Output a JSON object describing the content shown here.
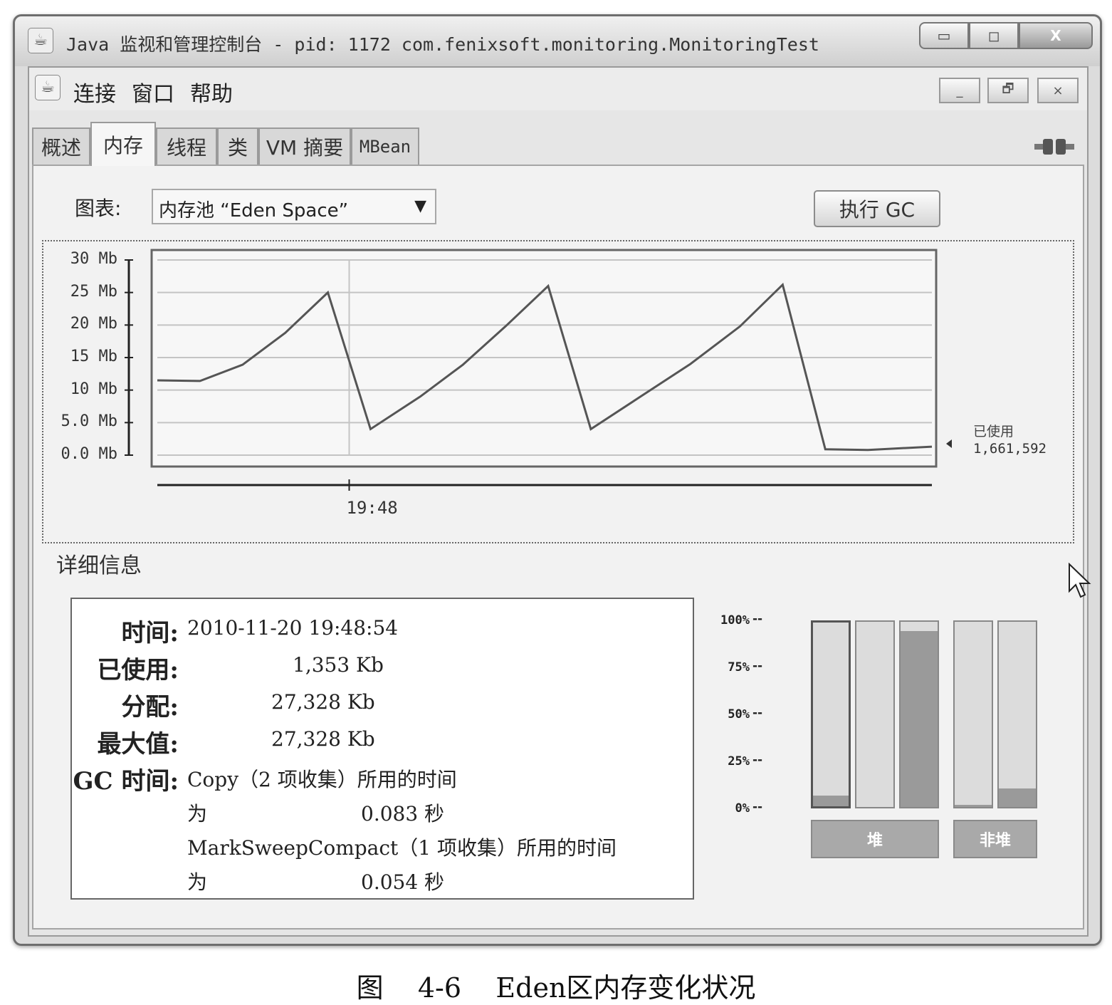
{
  "window": {
    "title": "Java 监视和管理控制台 - pid: 1172 com.fenixsoft.monitoring.MonitoringTest",
    "controls": {
      "minimize": "▭",
      "maximize": "◻",
      "close": "X"
    }
  },
  "menu": {
    "items": [
      "连接",
      "窗口",
      "帮助"
    ],
    "controls": {
      "minimize": "_",
      "restore": "🗗",
      "close": "×"
    }
  },
  "tabs": [
    {
      "label": "概述",
      "active": false
    },
    {
      "label": "内存",
      "active": true
    },
    {
      "label": "线程",
      "active": false
    },
    {
      "label": "类",
      "active": false
    },
    {
      "label": "VM 摘要",
      "active": false
    },
    {
      "label": "MBean",
      "active": false
    }
  ],
  "toolbar": {
    "chart_label": "图表:",
    "chart_select_value": "内存池 “Eden Space”",
    "gc_button": "执行 GC"
  },
  "chart_data": {
    "type": "line",
    "y_tick_labels": [
      "30 Mb",
      "25 Mb",
      "20 Mb",
      "15 Mb",
      "10 Mb",
      "5.0 Mb",
      "0.0 Mb"
    ],
    "ylim": [
      0,
      30
    ],
    "x_tick_label": "19:48",
    "series": [
      {
        "name": "已使用",
        "points": [
          [
            0,
            11.5
          ],
          [
            6,
            11.4
          ],
          [
            12,
            13.9
          ],
          [
            18,
            18.8
          ],
          [
            24,
            25.0
          ],
          [
            30,
            4.0
          ],
          [
            37,
            9.0
          ],
          [
            43,
            13.9
          ],
          [
            49,
            19.8
          ],
          [
            55,
            26.0
          ],
          [
            61,
            4.0
          ],
          [
            68,
            9.0
          ],
          [
            75,
            14.0
          ],
          [
            82,
            19.8
          ],
          [
            88,
            26.2
          ],
          [
            94,
            0.9
          ],
          [
            100,
            0.8
          ],
          [
            109,
            1.3
          ]
        ],
        "current_value": "1,661,592"
      }
    ],
    "x_cursor": 27,
    "xlim": [
      0,
      109
    ]
  },
  "details": {
    "title": "详细信息",
    "rows": [
      {
        "label": "时间:",
        "value": "2010-11-20 19:48:54"
      },
      {
        "label": "已使用:",
        "value": "1,353 Kb"
      },
      {
        "label": "分配:",
        "value": "27,328 Kb"
      },
      {
        "label": "最大值:",
        "value": "27,328 Kb"
      },
      {
        "label": "GC 时间:",
        "value": "Copy（2 项收集）所用的时间"
      }
    ],
    "gc_line2": "为",
    "gc_copy_time": "0.083 秒",
    "gc_line3": "MarkSweepCompact（1 项收集）所用的时间",
    "gc_line4": "为",
    "gc_msc_time": "0.054 秒"
  },
  "memory_bars": {
    "pct_labels": [
      "100%",
      "75%",
      "50%",
      "25%",
      "0%"
    ],
    "bars": [
      {
        "fill_pct": 6,
        "selected": true
      },
      {
        "fill_pct": 0,
        "selected": false
      },
      {
        "fill_pct": 95,
        "selected": false
      },
      {
        "fill_pct": 1,
        "selected": false
      },
      {
        "fill_pct": 10,
        "selected": false
      }
    ],
    "groups": [
      "堆",
      "非堆"
    ]
  },
  "caption": "图    4-6    Eden区内存变化状况"
}
